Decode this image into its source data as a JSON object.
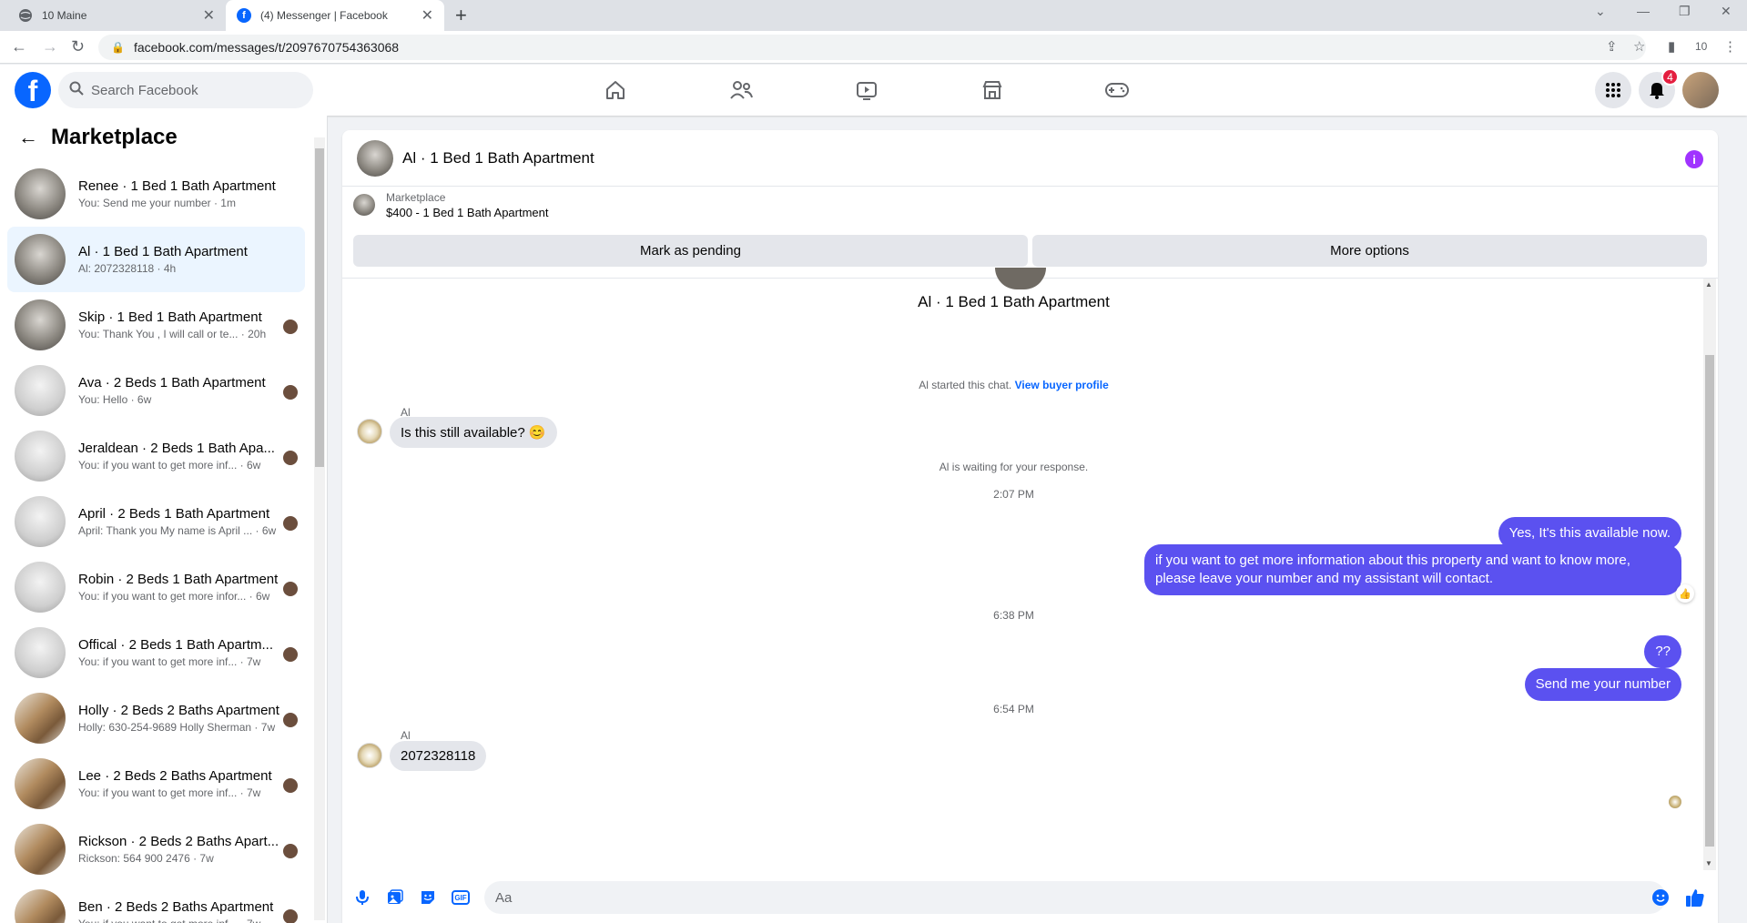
{
  "browser": {
    "tabs": [
      {
        "title": "10 Maine",
        "active": false
      },
      {
        "title": "(4) Messenger | Facebook",
        "active": true
      }
    ],
    "url": "facebook.com/messages/t/2097670754363068",
    "profile_count": "10"
  },
  "header": {
    "search_placeholder": "Search Facebook",
    "notification_count": "4"
  },
  "sidebar": {
    "title": "Marketplace",
    "conversations": [
      {
        "name": "Renee · 1 Bed 1 Bath Apartment",
        "snippet": "You: Send me your number · 1m",
        "thumb": "gray",
        "active": false
      },
      {
        "name": "Al · 1 Bed 1 Bath Apartment",
        "snippet": "Al: 2072328118 · 4h",
        "thumb": "gray",
        "active": true
      },
      {
        "name": "Skip · 1 Bed 1 Bath Apartment",
        "snippet": "You: Thank You , I will call or te... · 20h",
        "thumb": "gray",
        "active": false
      },
      {
        "name": "Ava · 2 Beds 1 Bath Apartment",
        "snippet": "You: Hello · 6w",
        "thumb": "white",
        "active": false
      },
      {
        "name": "Jeraldean · 2 Beds 1 Bath Apa...",
        "snippet": "You: if you want to get more inf... · 6w",
        "thumb": "white",
        "active": false
      },
      {
        "name": "April · 2 Beds 1 Bath Apartment",
        "snippet": "April: Thank you My name is April ... · 6w",
        "thumb": "white",
        "active": false
      },
      {
        "name": "Robin · 2 Beds 1 Bath Apartment",
        "snippet": "You: if you want to get more infor... · 6w",
        "thumb": "white",
        "active": false
      },
      {
        "name": "Offical · 2 Beds 1 Bath Apartm...",
        "snippet": "You: if you want to get more inf... · 7w",
        "thumb": "white",
        "active": false
      },
      {
        "name": "Holly · 2 Beds 2 Baths Apartment",
        "snippet": "Holly: 630-254-9689 Holly Sherman · 7w",
        "thumb": "kitchen",
        "active": false
      },
      {
        "name": "Lee · 2 Beds 2 Baths Apartment",
        "snippet": "You: if you want to get more inf... · 7w",
        "thumb": "kitchen",
        "active": false
      },
      {
        "name": "Rickson · 2 Beds 2 Baths Apart...",
        "snippet": "Rickson: 564 900 2476 · 7w",
        "thumb": "kitchen",
        "active": false
      },
      {
        "name": "Ben · 2 Beds 2 Baths Apartment",
        "snippet": "You: if you want to get more inf... · 7w",
        "thumb": "kitchen",
        "active": false
      }
    ]
  },
  "chat": {
    "title": "Al · 1 Bed 1 Bath Apartment",
    "listing_source": "Marketplace",
    "listing_price": "$400 - 1 Bed 1 Bath Apartment",
    "mark_pending": "Mark as pending",
    "more_options": "More options",
    "chat_name": "Al · 1 Bed 1 Bath Apartment",
    "started_text": "Al started this chat.",
    "view_profile": "View buyer profile",
    "sender1": "Al",
    "msg1": "Is this still available? 😊",
    "waiting": "Al is waiting for your response.",
    "time1": "2:07 PM",
    "out1": "Yes, It's this available now.",
    "out2": "if you want to get more information about this property and want to know more, please leave your number and my assistant will contact.",
    "time2": "6:38 PM",
    "out3": "??",
    "out4": "Send me your number",
    "time3": "6:54 PM",
    "sender2": "Al",
    "msg2": "2072328118",
    "composer_placeholder": "Aa"
  }
}
